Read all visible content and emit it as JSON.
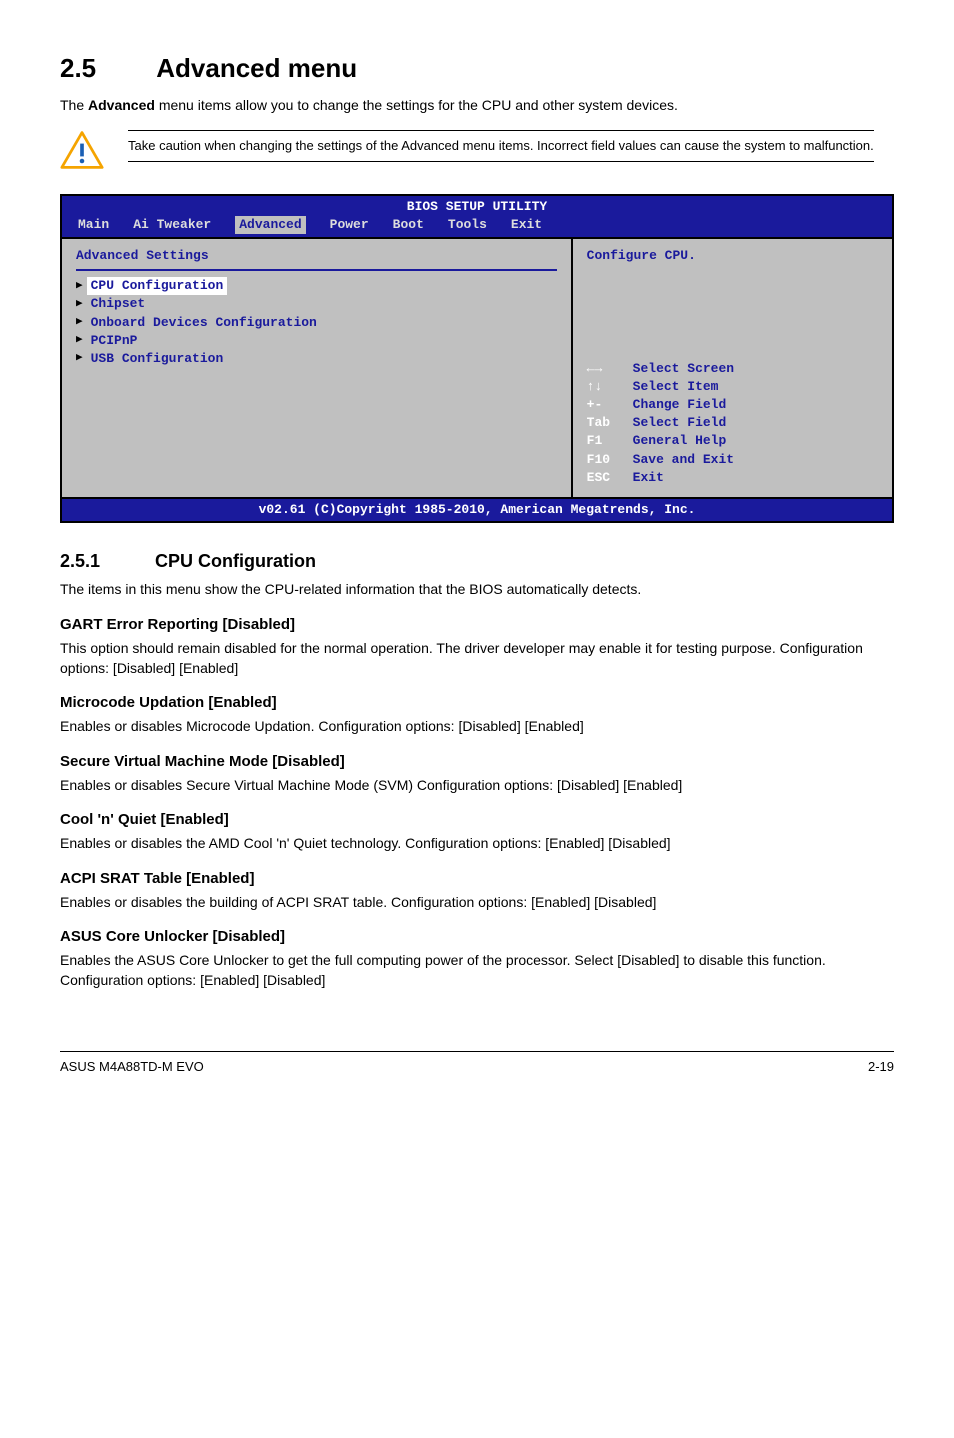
{
  "title": {
    "number": "2.5",
    "text": "Advanced menu"
  },
  "intro_pre": "The ",
  "intro_bold": "Advanced",
  "intro_post": " menu items allow you to change the settings for the CPU and other system devices.",
  "caution": "Take caution when changing the settings of the Advanced menu items. Incorrect field values can cause the system to malfunction.",
  "bios": {
    "title": "BIOS SETUP UTILITY",
    "tabs": [
      "Main",
      "Ai Tweaker",
      "Advanced",
      "Power",
      "Boot",
      "Tools",
      "Exit"
    ],
    "active_tab_index": 2,
    "left_heading": "Advanced Settings",
    "items": [
      "CPU Configuration",
      "Chipset",
      "Onboard Devices Configuration",
      "PCIPnP",
      "USB Configuration"
    ],
    "selected_index": 0,
    "help_top": "Configure CPU.",
    "keys": [
      {
        "sym": "←→",
        "desc": "Select Screen"
      },
      {
        "sym": "↑↓",
        "desc": "Select Item"
      },
      {
        "sym": "+-",
        "desc": "Change Field"
      },
      {
        "sym": "Tab",
        "desc": "Select Field"
      },
      {
        "sym": "F1",
        "desc": "General Help"
      },
      {
        "sym": "F10",
        "desc": "Save and Exit"
      },
      {
        "sym": "ESC",
        "desc": "Exit"
      }
    ],
    "footer": "v02.61 (C)Copyright 1985-2010, American Megatrends, Inc."
  },
  "subsection": {
    "number": "2.5.1",
    "text": "CPU Configuration"
  },
  "subsection_intro": "The items in this menu show the CPU-related information that the BIOS automatically detects.",
  "options": [
    {
      "h": "GART Error Reporting [Disabled]",
      "p": "This option should remain disabled for the normal operation. The driver developer may enable it for testing purpose. Configuration options: [Disabled] [Enabled]"
    },
    {
      "h": "Microcode Updation [Enabled]",
      "p": "Enables or disables Microcode Updation. Configuration options: [Disabled] [Enabled]"
    },
    {
      "h": "Secure Virtual Machine Mode [Disabled]",
      "p": "Enables or disables Secure Virtual Machine Mode (SVM) Configuration options: [Disabled] [Enabled]"
    },
    {
      "h": "Cool 'n' Quiet [Enabled]",
      "p": "Enables or disables the AMD Cool 'n' Quiet technology. Configuration options: [Enabled] [Disabled]"
    },
    {
      "h": "ACPI SRAT Table [Enabled]",
      "p": "Enables or disables the building of ACPI SRAT table. Configuration options: [Enabled] [Disabled]"
    },
    {
      "h": "ASUS Core Unlocker [Disabled]",
      "p": "Enables the ASUS Core Unlocker to get the full computing power of the processor. Select [Disabled] to disable this function. Configuration options: [Enabled] [Disabled]"
    }
  ],
  "footer": {
    "left": "ASUS M4A88TD-M EVO",
    "right": "2-19"
  }
}
